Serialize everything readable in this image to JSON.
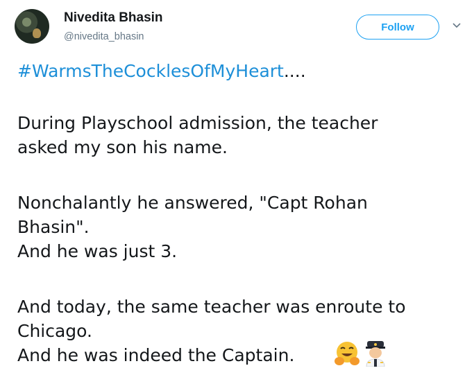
{
  "tweet": {
    "author_name": "Nivedita Bhasin",
    "author_handle": "@nivedita_bhasin",
    "follow_label": "Follow",
    "hashtag": "#WarmsTheCocklesOfMyHeart",
    "hashtag_suffix": "....",
    "paragraph1": [
      "During Playschool admission, the teacher",
      "asked my son his name."
    ],
    "paragraph2": [
      "Nonchalantly he answered, \"Capt Rohan",
      "Bhasin\".",
      "And he was just 3."
    ],
    "paragraph3": [
      "And today, the same teacher was enroute to",
      "Chicago.",
      "And he was indeed the Captain."
    ],
    "emojis": [
      "hugging-face-icon",
      "pilot-icon"
    ]
  },
  "colors": {
    "accent": "#1da1f2",
    "hashtag": "#1d8fd8",
    "text": "#14171a",
    "muted": "#657786"
  }
}
